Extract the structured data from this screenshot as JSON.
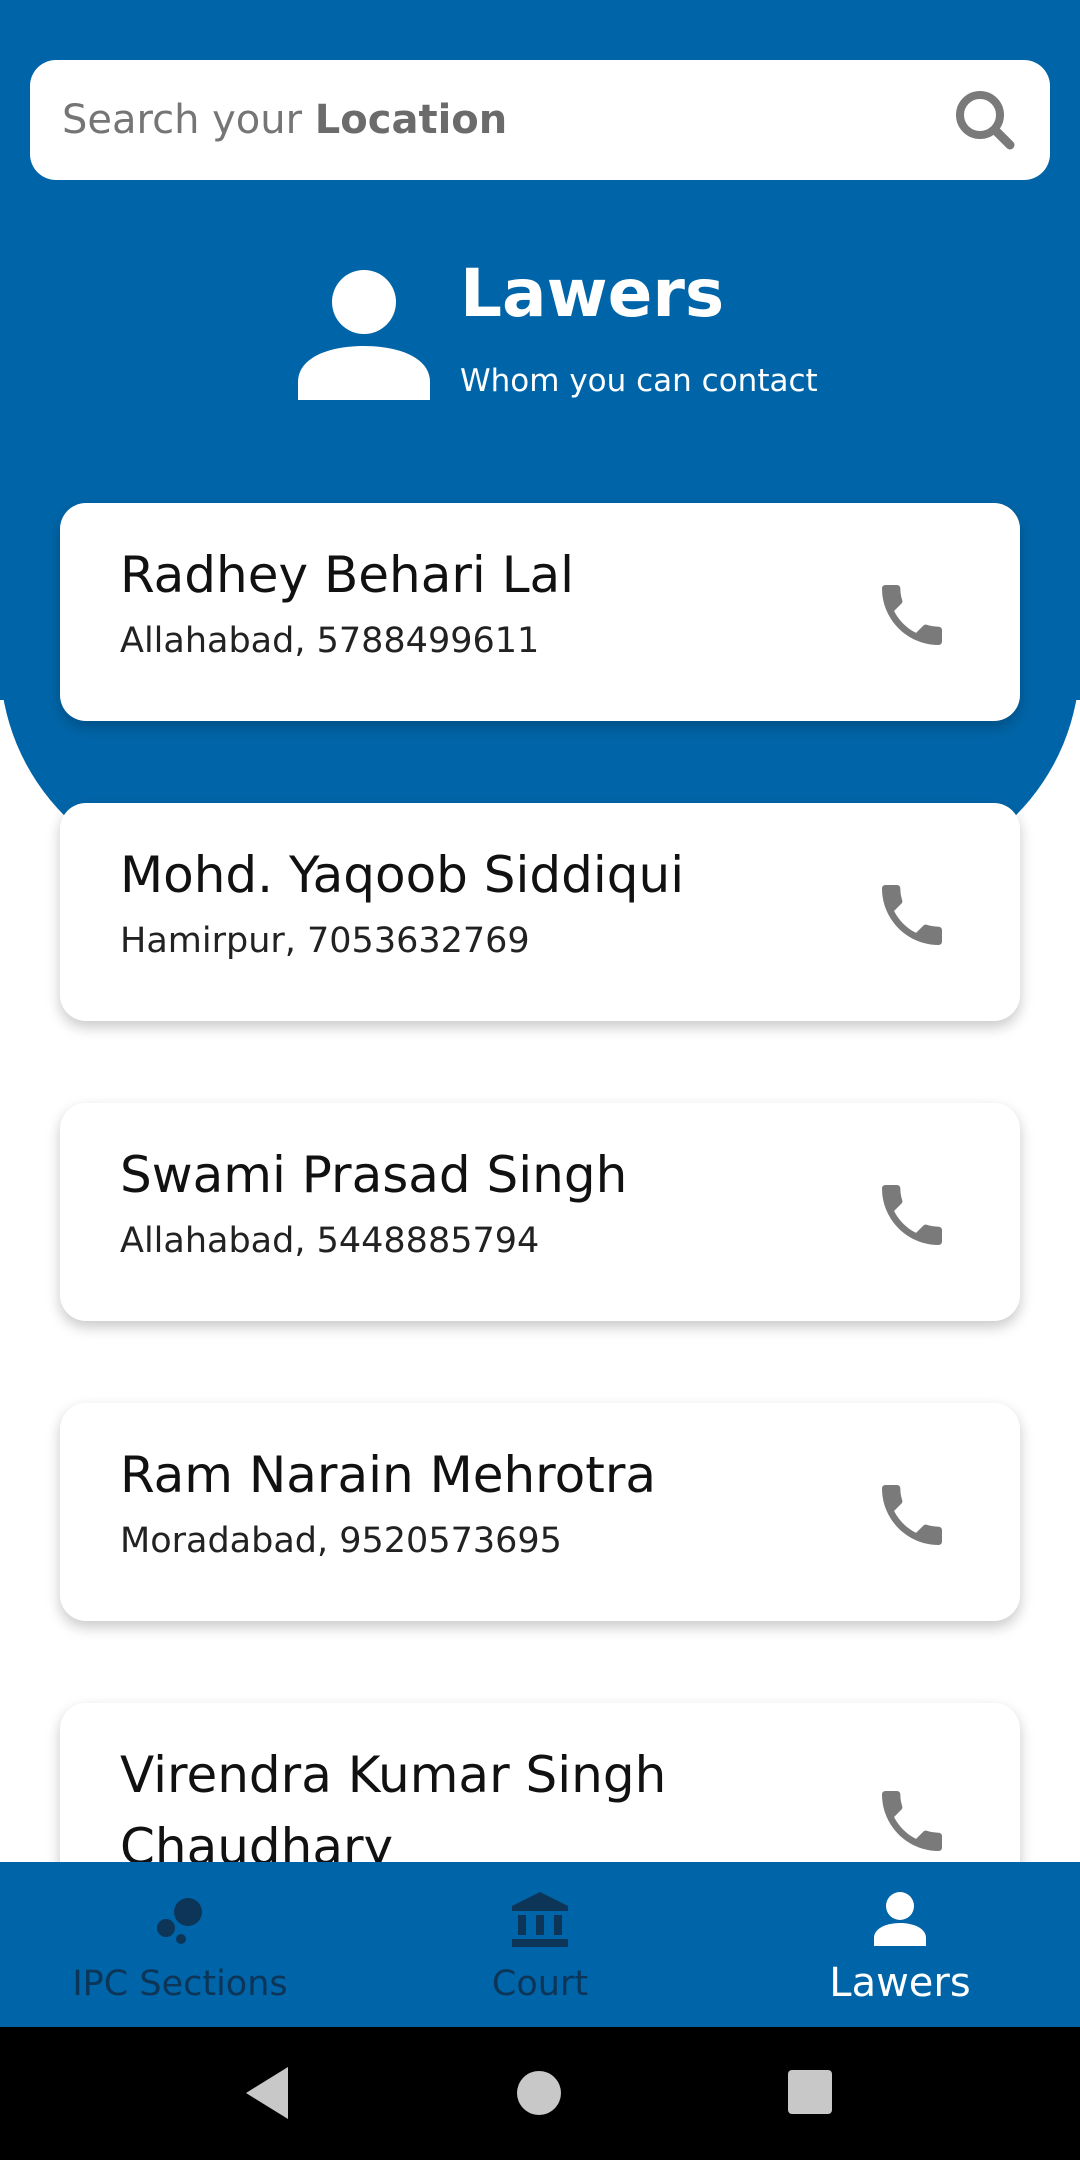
{
  "colors": {
    "primary": "#0065a8",
    "nav_inactive": "#0c3558",
    "icon_gray": "#7a7a7a"
  },
  "search": {
    "placeholder_prefix": "Search your ",
    "placeholder_bold": "Location",
    "icon": "search-icon"
  },
  "hero": {
    "icon": "person-icon",
    "title": "Lawers",
    "subtitle": "Whom you can contact"
  },
  "lawyers": [
    {
      "name": "Radhey Behari Lal",
      "detail": "Allahabad, 5788499611"
    },
    {
      "name": "Mohd. Yaqoob Siddiqui",
      "detail": "Hamirpur, 7053632769"
    },
    {
      "name": "Swami Prasad Singh",
      "detail": "Allahabad, 5448885794"
    },
    {
      "name": "Ram Narain Mehrotra",
      "detail": "Moradabad, 9520573695"
    },
    {
      "name": "Virendra Kumar Singh Chaudhary",
      "detail": ""
    }
  ],
  "bottom_nav": {
    "items": [
      {
        "label": "IPC Sections",
        "icon": "bubbles-icon",
        "active": false
      },
      {
        "label": "Court",
        "icon": "bank-icon",
        "active": false
      },
      {
        "label": "Lawers",
        "icon": "person-icon",
        "active": true
      }
    ]
  },
  "system_nav": {
    "back": "back-icon",
    "home": "home-icon",
    "recents": "recents-icon"
  }
}
